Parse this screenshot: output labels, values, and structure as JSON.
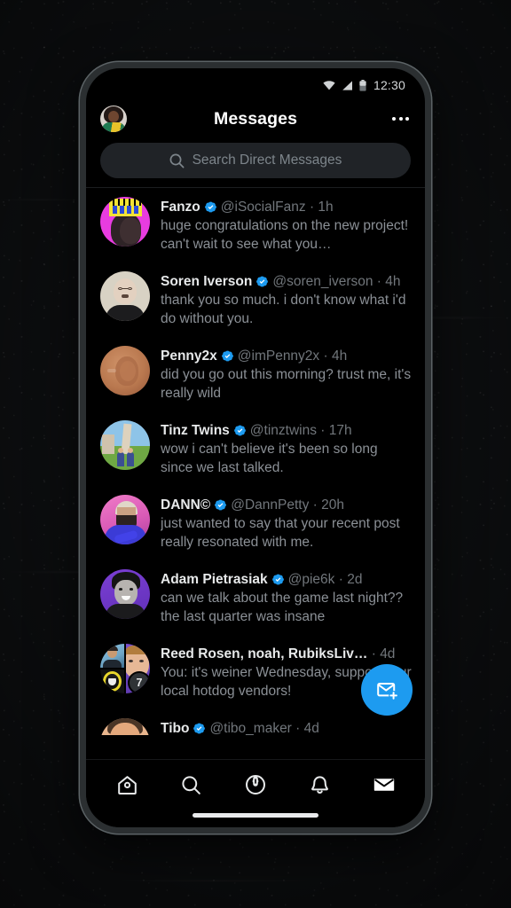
{
  "status_bar": {
    "time": "12:30",
    "icons": [
      "wifi-icon",
      "cellular-signal-icon",
      "battery-icon"
    ]
  },
  "header": {
    "title": "Messages",
    "avatar_name": "profile-avatar",
    "more_label": "More options"
  },
  "search": {
    "placeholder": "Search Direct Messages",
    "icon": "search-icon"
  },
  "colors": {
    "accent": "#1d9bf0",
    "verified_badge": "#1d9bf0",
    "background": "#000000",
    "search_field": "#202327",
    "primary_text": "#e7e9ea",
    "secondary_text": "#71767b",
    "preview_text": "#8b9096",
    "phone_frame": "#2b2f31",
    "page_background": "#101214"
  },
  "conversations": [
    {
      "name": "Fanzo",
      "verified": true,
      "handle": "@iSocialFanz",
      "time": "1h",
      "preview": "huge congratulations on the new project! can't wait to see what you…",
      "avatar": "fanzo-avatar"
    },
    {
      "name": "Soren Iverson",
      "verified": true,
      "handle": "@soren_iverson",
      "time": "4h",
      "preview": "thank you so much. i don't know what i'd do without you.",
      "avatar": "soren-iverson-avatar"
    },
    {
      "name": "Penny2x",
      "verified": true,
      "handle": "@imPenny2x",
      "time": "4h",
      "preview": "did you go out this morning? trust me, it's really wild",
      "avatar": "penny2x-avatar"
    },
    {
      "name": "Tinz Twins",
      "verified": true,
      "handle": "@tinztwins",
      "time": "17h",
      "preview": "wow i can't believe it's been so long since we last talked.",
      "avatar": "tinz-twins-avatar"
    },
    {
      "name": "DANN©",
      "verified": true,
      "handle": "@DannPetty",
      "time": "20h",
      "preview": "just wanted to say that your recent post really resonated with me.",
      "avatar": "dann-avatar"
    },
    {
      "name": "Adam Pietrasiak",
      "verified": true,
      "handle": "@pie6k",
      "time": "2d",
      "preview": "can we talk about the game last night?? the last quarter was insane",
      "avatar": "adam-pietrasiak-avatar"
    },
    {
      "name": "Reed Rosen, noah, RubiksLiv…",
      "verified": false,
      "handle": "",
      "time": "4d",
      "preview": "You: it's weiner Wednesday, support your local hotdog vendors!",
      "avatar": "group-avatar",
      "group": true,
      "group_count": "7"
    },
    {
      "name": "Tibo",
      "verified": true,
      "handle": "@tibo_maker",
      "time": "4d",
      "preview": "",
      "avatar": "tibo-avatar"
    }
  ],
  "compose": {
    "label": "New message",
    "icon": "compose-message-icon"
  },
  "bottom_nav": {
    "items": [
      {
        "name": "home",
        "icon": "home-icon",
        "active": false
      },
      {
        "name": "search",
        "icon": "search-icon",
        "active": false
      },
      {
        "name": "spaces",
        "icon": "spaces-microphone-icon",
        "active": false
      },
      {
        "name": "notifications",
        "icon": "bell-icon",
        "active": false
      },
      {
        "name": "messages",
        "icon": "envelope-icon",
        "active": true
      }
    ]
  }
}
